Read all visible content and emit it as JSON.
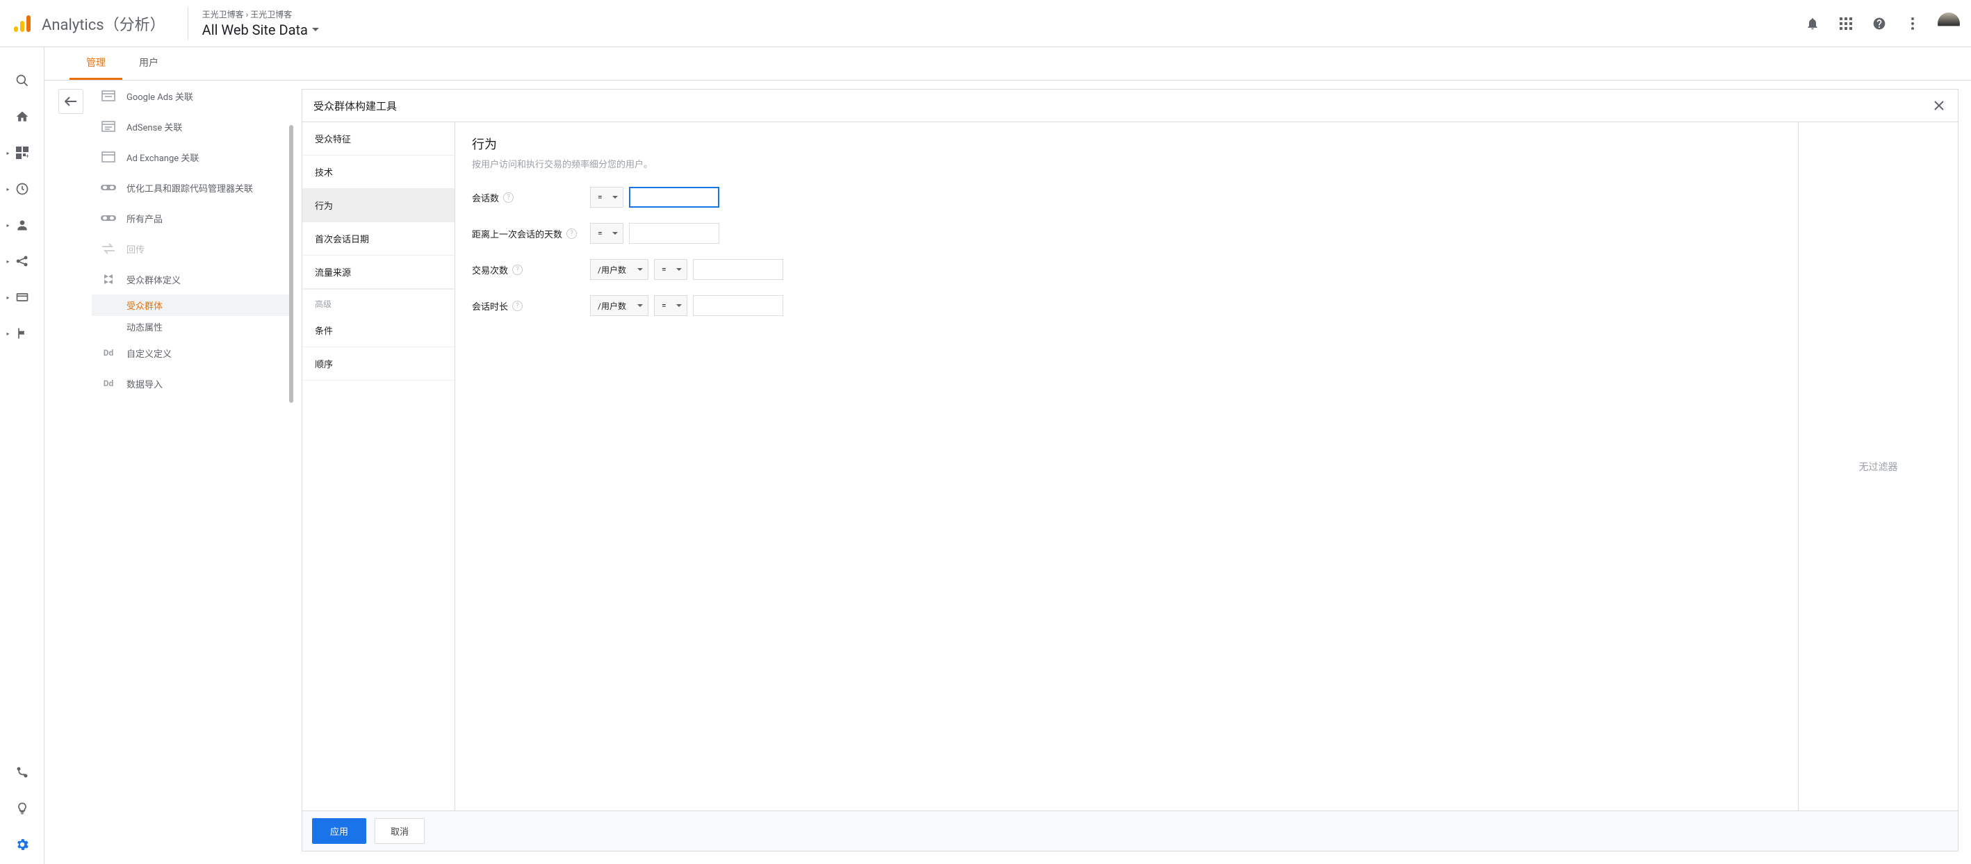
{
  "header": {
    "product_name": "Analytics（分析）",
    "breadcrumb_account": "王光卫博客",
    "breadcrumb_sep": " › ",
    "breadcrumb_property": "王光卫博客",
    "view_name": "All Web Site Data"
  },
  "tabs": {
    "admin": "管理",
    "user": "用户"
  },
  "settings_list": {
    "google_ads": "Google Ads 关联",
    "adsense": "AdSense 关联",
    "ad_exchange": "Ad Exchange 关联",
    "optimize": "优化工具和跟踪代码管理器关联",
    "all_products": "所有产品",
    "postback": "回传",
    "audience_def": "受众群体定义",
    "sub_audience": "受众群体",
    "sub_dynamic": "动态属性",
    "custom_def": "自定义定义",
    "data_import": "数据导入"
  },
  "builder": {
    "title": "受众群体构建工具",
    "categories": {
      "demographics": "受众特征",
      "technology": "技术",
      "behavior": "行为",
      "first_session": "首次会话日期",
      "traffic_sources": "流量来源",
      "advanced_label": "高级",
      "conditions": "条件",
      "sequences": "顺序"
    },
    "form": {
      "title": "行为",
      "desc": "按用户访问和执行交易的频率细分您的用户。",
      "sessions": "会话数",
      "days_since": "距离上一次会话的天数",
      "transactions": "交易次数",
      "session_duration": "会话时长",
      "op_eq": "=",
      "per_user": "/用户数"
    },
    "right_pane": "无过滤器",
    "apply": "应用",
    "cancel": "取消"
  }
}
